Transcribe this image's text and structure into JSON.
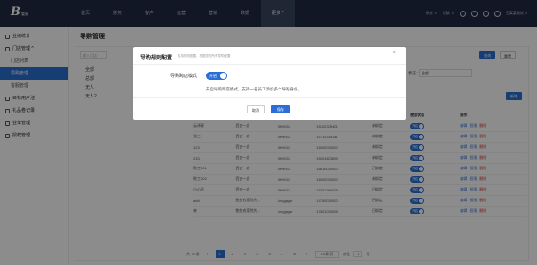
{
  "app": {
    "logo": "B",
    "logo_sub": "管家"
  },
  "nav": {
    "items": [
      "首页",
      "财务",
      "客户",
      "运营",
      "营销",
      "数据",
      "更多 ^"
    ],
    "active_index": 6
  },
  "topright": {
    "label_1": "系统 ∨",
    "label_2": "切换 ∨",
    "user": "王某某测试 ∨"
  },
  "sidebar": {
    "items": [
      {
        "label": "业绩统计",
        "sub": false,
        "active": false
      },
      {
        "label": "门店管理 ^",
        "sub": false,
        "active": false
      },
      {
        "label": "门店列表",
        "sub": true,
        "active": false
      },
      {
        "label": "导购管理",
        "sub": true,
        "active": true
      },
      {
        "label": "客服管理",
        "sub": true,
        "active": false
      },
      {
        "label": "目标用户池",
        "sub": false,
        "active": false
      },
      {
        "label": "礼品卷记录",
        "sub": false,
        "active": false
      },
      {
        "label": "业单管理",
        "sub": false,
        "active": false
      },
      {
        "label": "授权管理",
        "sub": false,
        "active": false
      }
    ]
  },
  "page": {
    "title": "导购管理",
    "filter_placeholder": "输入门店",
    "status_label": "状态：",
    "status_value": "全部",
    "search": "查询",
    "reset": "重置",
    "add": "新增"
  },
  "tree": {
    "items": [
      "全部",
      "总部",
      "无人",
      "无人2"
    ]
  },
  "table": {
    "columns": [
      "姓名",
      "门店",
      "工号",
      "手机号",
      "绑定状态",
      "使用状态",
      "操作"
    ],
    "rows": [
      [
        "云泽豪",
        "西安一店",
        "IMH001",
        "15102325401",
        "未绑定",
        "开启"
      ],
      [
        "张三",
        "西安一店",
        "IMH001",
        "15712334141",
        "未绑定",
        "开启"
      ],
      [
        "123",
        "西安一店",
        "IMH001",
        "15000000000",
        "未绑定",
        "开启"
      ],
      [
        "233",
        "西安一店",
        "IMH001",
        "15001823899",
        "未绑定",
        "开启"
      ],
      [
        "陈工001",
        "西安一店",
        "IMH001",
        "18610000000",
        "已绑定",
        "开启"
      ],
      [
        "陈工002",
        "西安一店",
        "IMH001",
        "18000000000",
        "未绑定",
        "开启"
      ],
      [
        "小心号",
        "西安一店",
        "IMH001",
        "18201380008",
        "已绑定",
        "开启"
      ],
      [
        "add",
        "鲍鱼农家院先...",
        "langgege",
        "14700000000",
        "已绑定",
        "开启"
      ],
      [
        "来",
        "鲍鱼农家院先...",
        "langgege",
        "13301000008",
        "已绑定",
        "开启"
      ]
    ],
    "actions": [
      "编辑",
      "权限",
      "删除"
    ]
  },
  "pager": {
    "total": "共 75 条",
    "pages": [
      "1",
      "2",
      "3",
      "4",
      "5",
      "...",
      "8"
    ],
    "current": "1",
    "per_page": "10条/页",
    "goto": "前往",
    "goto_val": "1",
    "page_word": "页"
  },
  "modal": {
    "title": "导购规则配置",
    "subtitle": "支持规则配置，根据您的所有导购配置",
    "close": "×",
    "field_label": "导购跨店模式",
    "toggle_text": "开启",
    "description": "开启导购跨店模式，支持一名员工添加多个导购身份。",
    "cancel": "取消",
    "ok": "保存"
  },
  "colors": {
    "topbar": "#1f2a44",
    "primary": "#2b6fd6",
    "danger": "#dd3333"
  }
}
